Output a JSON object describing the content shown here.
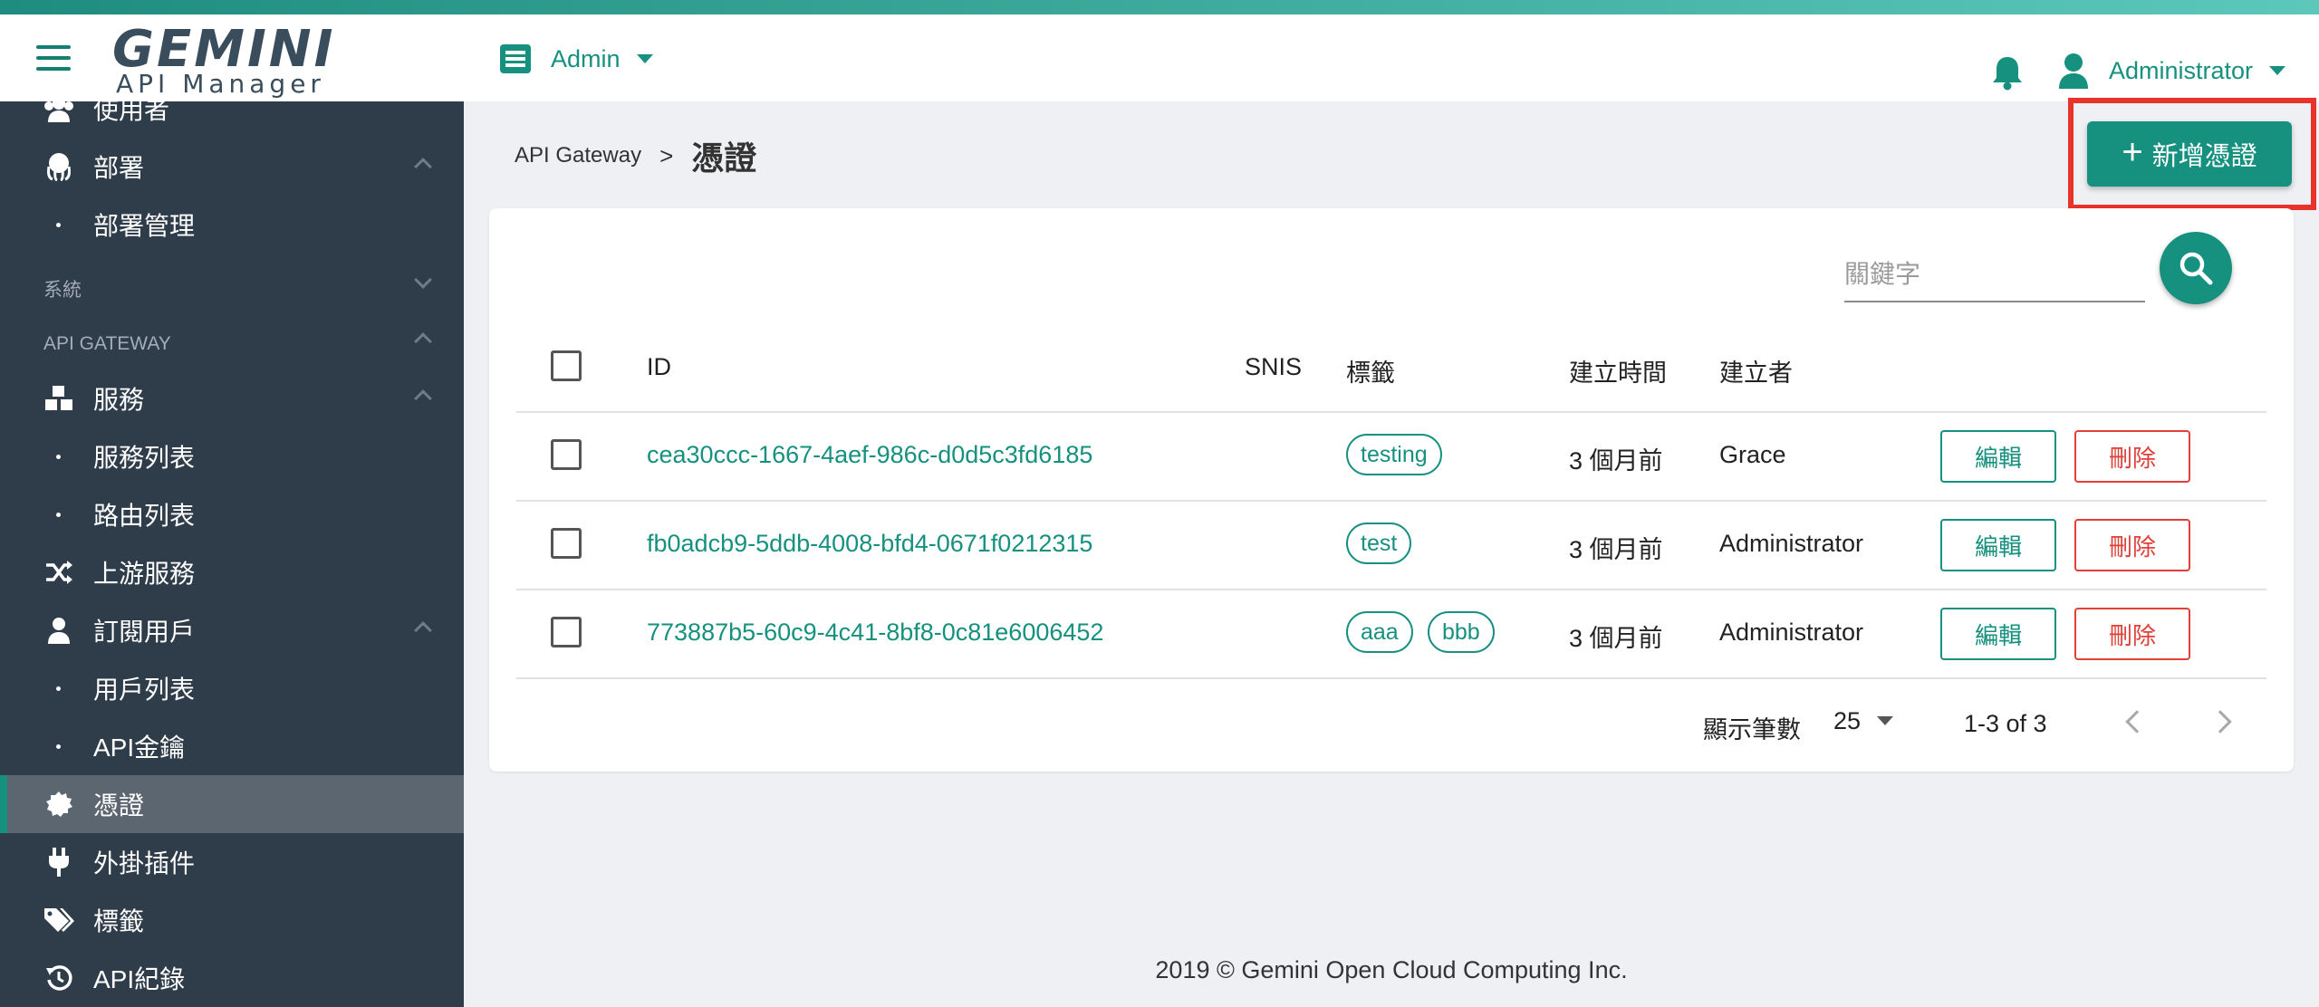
{
  "header": {
    "logo_main": "GEMINI",
    "logo_sub": "API Manager",
    "admin_menu_label": "Admin",
    "user_menu_label": "Administrator"
  },
  "sidebar": {
    "items": [
      {
        "label": "使用者",
        "icon": "users-icon"
      },
      {
        "label": "部署",
        "icon": "octopus-icon"
      },
      {
        "label": "部署管理"
      },
      {
        "label": "服務",
        "icon": "cubes-icon"
      },
      {
        "label": "服務列表"
      },
      {
        "label": "路由列表"
      },
      {
        "label": "上游服務",
        "icon": "shuffle-icon"
      },
      {
        "label": "訂閱用戶",
        "icon": "user-icon"
      },
      {
        "label": "用戶列表"
      },
      {
        "label": "API金鑰"
      },
      {
        "label": "憑證",
        "icon": "certificate-icon"
      },
      {
        "label": "外掛插件",
        "icon": "plug-icon"
      },
      {
        "label": "標籤",
        "icon": "tags-icon"
      },
      {
        "label": "API紀錄",
        "icon": "history-icon"
      }
    ],
    "sections": [
      "系統",
      "API GATEWAY"
    ]
  },
  "breadcrumb": {
    "root": "API Gateway",
    "separator": ">",
    "current": "憑證"
  },
  "toolbar": {
    "add_label": "新增憑證"
  },
  "search": {
    "placeholder": "關鍵字"
  },
  "table": {
    "headers": {
      "id": "ID",
      "snis": "SNIS",
      "tags": "標籤",
      "created": "建立時間",
      "creator": "建立者"
    },
    "edit_label": "編輯",
    "delete_label": "刪除",
    "rows": [
      {
        "id": "cea30ccc-1667-4aef-986c-d0d5c3fd6185",
        "snis": "",
        "tags": [
          "testing"
        ],
        "created": "3 個月前",
        "creator": "Grace"
      },
      {
        "id": "fb0adcb9-5ddb-4008-bfd4-0671f0212315",
        "snis": "",
        "tags": [
          "test"
        ],
        "created": "3 個月前",
        "creator": "Administrator"
      },
      {
        "id": "773887b5-60c9-4c41-8bf8-0c81e6006452",
        "snis": "",
        "tags": [
          "aaa",
          "bbb"
        ],
        "created": "3 個月前",
        "creator": "Administrator"
      }
    ]
  },
  "pagination": {
    "rows_label": "顯示筆數",
    "rows_per_page": "25",
    "range": "1-3 of 3"
  },
  "footer": {
    "text": "2019 © Gemini Open Cloud Computing Inc."
  },
  "colors": {
    "primary": "#16907f",
    "sidebar_bg": "#2f3c4a",
    "danger": "#e0403a",
    "highlight": "#e8332a"
  }
}
